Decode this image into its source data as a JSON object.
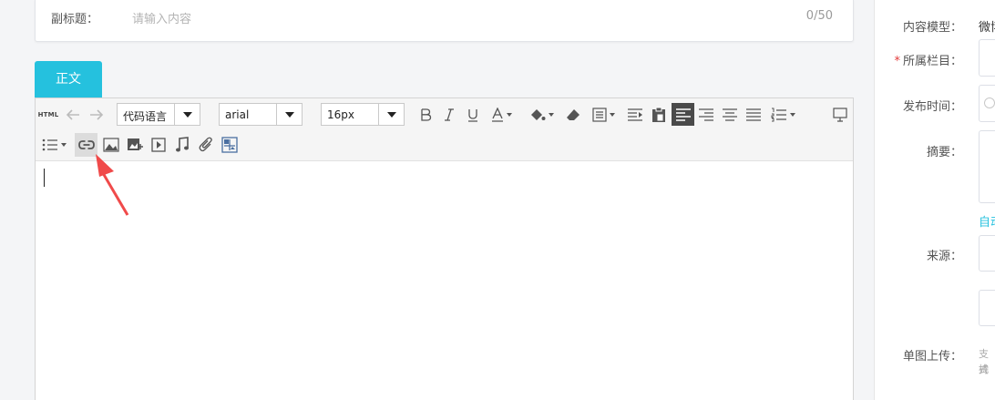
{
  "subtitle": {
    "label": "副标题：",
    "placeholder": "请输入内容",
    "count": "0/50"
  },
  "tab": {
    "label": "正文"
  },
  "toolbar": {
    "html_label": "HTML",
    "code_language": "代码语言",
    "font_family": "arial",
    "font_size": "16px",
    "icons_row1": [
      "html-icon",
      "undo-icon",
      "redo-icon",
      "bold-icon",
      "italic-icon",
      "underline-icon",
      "font-color-icon",
      "fill-color-icon",
      "eraser-icon",
      "paragraph-format-icon",
      "indent-icon",
      "paste-icon",
      "align-left-icon",
      "align-right-icon",
      "align-center-icon",
      "align-justify-icon",
      "ordered-list-icon",
      "preview-icon"
    ],
    "icons_row2": [
      "unordered-list-icon",
      "link-icon",
      "image-icon",
      "multi-image-icon",
      "video-icon",
      "music-icon",
      "attachment-icon",
      "gallery-icon"
    ]
  },
  "right_panel": {
    "content_model_label": "内容模型：",
    "content_model_value": "微博",
    "column_label": "所属栏目：",
    "column_required": "*",
    "publish_time_label": "发布时间：",
    "summary_label": "摘要：",
    "auto_extract_link": "自动",
    "source_label": "来源：",
    "single_image_label": "单图上传：",
    "upload_hint_line1": "支持",
    "upload_hint_line2": "式"
  },
  "colors": {
    "accent": "#25c1de",
    "required": "#e23b3b",
    "annotation_arrow": "#f04a4a"
  }
}
